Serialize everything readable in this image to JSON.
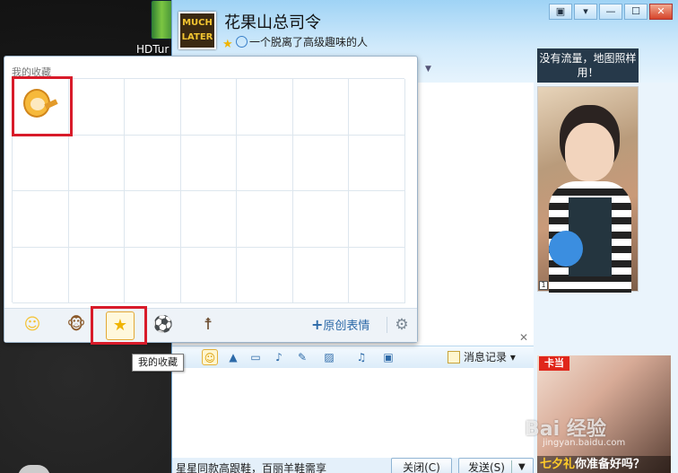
{
  "desktop": {
    "icon_label": "HDTur"
  },
  "chat": {
    "contact_name": "花果山总司令",
    "avatar_text": "MUCH LATER",
    "status_text": "一个脱离了高级趣味的人",
    "win_controls": [
      "▣",
      "▾",
      "—",
      "☐",
      "✕"
    ],
    "history_record_label": "消息记录",
    "bottom_tip": "星星同款高跟鞋，百丽羊鞋需享",
    "close_label": "关闭(C)",
    "send_label": "发送(S)"
  },
  "ads": {
    "top_text": "没有流量，地图照样用！",
    "page_number": "1",
    "bottom_brand": "卡当",
    "bottom_caption_red": "七夕礼",
    "bottom_caption": "你准备好吗？"
  },
  "emoji_panel": {
    "title": "我的收藏",
    "tabs": [
      {
        "name": "smile",
        "icon": "☺"
      },
      {
        "name": "monkey",
        "icon": "🐵"
      },
      {
        "name": "favorites",
        "icon": "★"
      },
      {
        "name": "ball",
        "icon": "⚽"
      },
      {
        "name": "figure",
        "icon": "☨"
      }
    ],
    "add_label": "原创表情",
    "tooltip": "我的收藏"
  },
  "watermark": {
    "text": "Bai 经验",
    "sub": "jingyan.baidu.com"
  },
  "colors": {
    "highlight": "#d81b2a",
    "title_bar": "#9fd3f5",
    "link": "#2d6aa8"
  }
}
